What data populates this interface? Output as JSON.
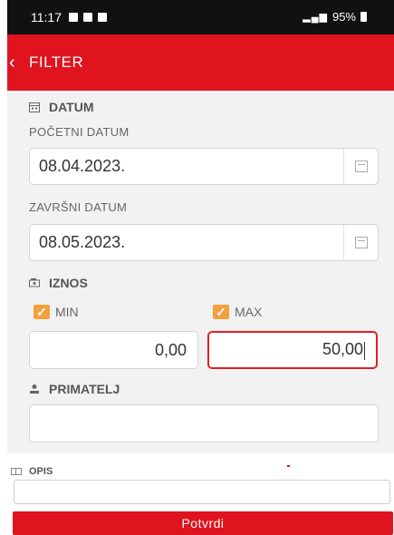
{
  "status_bar": {
    "time": "11:17",
    "battery": "95%"
  },
  "appbar": {
    "back_glyph": "‹",
    "title": "FILTER"
  },
  "datum": {
    "section_title": "DATUM",
    "start_label": "POČETNI DATUM",
    "start_value": "08.04.2023.",
    "end_label": "ZAVRŠNI DATUM",
    "end_value": "08.05.2023."
  },
  "iznos": {
    "section_title": "IZNOS",
    "min_label": "MIN",
    "min_checked": true,
    "min_value": "0,00",
    "max_label": "MAX",
    "max_checked": true,
    "max_value": "50,00"
  },
  "primatelj": {
    "section_title": "PRIMATELJ",
    "value": ""
  },
  "opis": {
    "section_title": "OPIS",
    "value": ""
  },
  "submit_label": "Potvrdi",
  "colors": {
    "accent": "#e0141e",
    "checkbox": "#f4a03c",
    "background": "#f2f2f2"
  },
  "icons": {
    "datum": "calendar-icon",
    "iznos": "money-icon",
    "primatelj": "person-icon",
    "opis": "text-field-icon"
  }
}
